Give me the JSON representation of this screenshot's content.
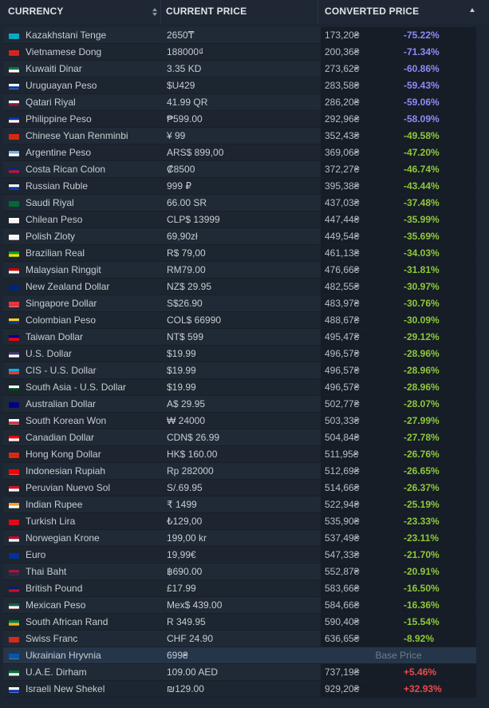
{
  "header": {
    "currency": "CURRENCY",
    "current_price": "CURRENT PRICE",
    "converted_price": "CONVERTED PRICE"
  },
  "rows": [
    {
      "flag": "kz",
      "name": "Kazakhstani Tenge",
      "price": "2650₸",
      "converted": "173,20₴",
      "pct": "-75.22%",
      "cls": "blue"
    },
    {
      "flag": "vn",
      "name": "Vietnamese Dong",
      "price": "188000₫",
      "converted": "200,36₴",
      "pct": "-71.34%",
      "cls": "blue"
    },
    {
      "flag": "kw",
      "name": "Kuwaiti Dinar",
      "price": "3.35 KD",
      "converted": "273,62₴",
      "pct": "-60.86%",
      "cls": "blue"
    },
    {
      "flag": "uy",
      "name": "Uruguayan Peso",
      "price": "$U429",
      "converted": "283,58₴",
      "pct": "-59.43%",
      "cls": "blue"
    },
    {
      "flag": "qa",
      "name": "Qatari Riyal",
      "price": "41.99 QR",
      "converted": "286,20₴",
      "pct": "-59.06%",
      "cls": "blue"
    },
    {
      "flag": "ph",
      "name": "Philippine Peso",
      "price": "₱599.00",
      "converted": "292,96₴",
      "pct": "-58.09%",
      "cls": "blue"
    },
    {
      "flag": "cn",
      "name": "Chinese Yuan Renminbi",
      "price": "¥ 99",
      "converted": "352,43₴",
      "pct": "-49.58%",
      "cls": "green"
    },
    {
      "flag": "ar",
      "name": "Argentine Peso",
      "price": "ARS$ 899,00",
      "converted": "369,06₴",
      "pct": "-47.20%",
      "cls": "green"
    },
    {
      "flag": "cr",
      "name": "Costa Rican Colon",
      "price": "₡8500",
      "converted": "372,27₴",
      "pct": "-46.74%",
      "cls": "green"
    },
    {
      "flag": "ru",
      "name": "Russian Ruble",
      "price": "999 ₽",
      "converted": "395,38₴",
      "pct": "-43.44%",
      "cls": "green"
    },
    {
      "flag": "sa",
      "name": "Saudi Riyal",
      "price": "66.00 SR",
      "converted": "437,03₴",
      "pct": "-37.48%",
      "cls": "green"
    },
    {
      "flag": "cl",
      "name": "Chilean Peso",
      "price": "CLP$ 13999",
      "converted": "447,44₴",
      "pct": "-35.99%",
      "cls": "green"
    },
    {
      "flag": "pl",
      "name": "Polish Zloty",
      "price": "69,90zł",
      "converted": "449,54₴",
      "pct": "-35.69%",
      "cls": "green"
    },
    {
      "flag": "br",
      "name": "Brazilian Real",
      "price": "R$ 79,00",
      "converted": "461,13₴",
      "pct": "-34.03%",
      "cls": "green"
    },
    {
      "flag": "my",
      "name": "Malaysian Ringgit",
      "price": "RM79.00",
      "converted": "476,66₴",
      "pct": "-31.81%",
      "cls": "green"
    },
    {
      "flag": "nz",
      "name": "New Zealand Dollar",
      "price": "NZ$ 29.95",
      "converted": "482,55₴",
      "pct": "-30.97%",
      "cls": "green"
    },
    {
      "flag": "sg",
      "name": "Singapore Dollar",
      "price": "S$26.90",
      "converted": "483,97₴",
      "pct": "-30.76%",
      "cls": "green"
    },
    {
      "flag": "co",
      "name": "Colombian Peso",
      "price": "COL$ 66990",
      "converted": "488,67₴",
      "pct": "-30.09%",
      "cls": "green"
    },
    {
      "flag": "tw",
      "name": "Taiwan Dollar",
      "price": "NT$ 599",
      "converted": "495,47₴",
      "pct": "-29.12%",
      "cls": "green"
    },
    {
      "flag": "us",
      "name": "U.S. Dollar",
      "price": "$19.99",
      "converted": "496,57₴",
      "pct": "-28.96%",
      "cls": "green"
    },
    {
      "flag": "az",
      "name": "CIS - U.S. Dollar",
      "price": "$19.99",
      "converted": "496,57₴",
      "pct": "-28.96%",
      "cls": "green"
    },
    {
      "flag": "pk",
      "name": "South Asia - U.S. Dollar",
      "price": "$19.99",
      "converted": "496,57₴",
      "pct": "-28.96%",
      "cls": "green"
    },
    {
      "flag": "au",
      "name": "Australian Dollar",
      "price": "A$ 29.95",
      "converted": "502,77₴",
      "pct": "-28.07%",
      "cls": "green"
    },
    {
      "flag": "kr",
      "name": "South Korean Won",
      "price": "₩ 24000",
      "converted": "503,33₴",
      "pct": "-27.99%",
      "cls": "green"
    },
    {
      "flag": "ca",
      "name": "Canadian Dollar",
      "price": "CDN$ 26.99",
      "converted": "504,84₴",
      "pct": "-27.78%",
      "cls": "green"
    },
    {
      "flag": "hk",
      "name": "Hong Kong Dollar",
      "price": "HK$ 160.00",
      "converted": "511,95₴",
      "pct": "-26.76%",
      "cls": "green"
    },
    {
      "flag": "id",
      "name": "Indonesian Rupiah",
      "price": "Rp 282000",
      "converted": "512,69₴",
      "pct": "-26.65%",
      "cls": "green"
    },
    {
      "flag": "pe",
      "name": "Peruvian Nuevo Sol",
      "price": "S/.69.95",
      "converted": "514,66₴",
      "pct": "-26.37%",
      "cls": "green"
    },
    {
      "flag": "in",
      "name": "Indian Rupee",
      "price": "₹ 1499",
      "converted": "522,94₴",
      "pct": "-25.19%",
      "cls": "green"
    },
    {
      "flag": "tr",
      "name": "Turkish Lira",
      "price": "₺129,00",
      "converted": "535,90₴",
      "pct": "-23.33%",
      "cls": "green"
    },
    {
      "flag": "no",
      "name": "Norwegian Krone",
      "price": "199,00 kr",
      "converted": "537,49₴",
      "pct": "-23.11%",
      "cls": "green"
    },
    {
      "flag": "eu",
      "name": "Euro",
      "price": "19,99€",
      "converted": "547,33₴",
      "pct": "-21.70%",
      "cls": "green"
    },
    {
      "flag": "th",
      "name": "Thai Baht",
      "price": "฿690.00",
      "converted": "552,87₴",
      "pct": "-20.91%",
      "cls": "green"
    },
    {
      "flag": "gb",
      "name": "British Pound",
      "price": "£17.99",
      "converted": "583,66₴",
      "pct": "-16.50%",
      "cls": "green"
    },
    {
      "flag": "mx",
      "name": "Mexican Peso",
      "price": "Mex$ 439.00",
      "converted": "584,66₴",
      "pct": "-16.36%",
      "cls": "green"
    },
    {
      "flag": "za",
      "name": "South African Rand",
      "price": "R 349.95",
      "converted": "590,40₴",
      "pct": "-15.54%",
      "cls": "green"
    },
    {
      "flag": "ch",
      "name": "Swiss Franc",
      "price": "CHF 24.90",
      "converted": "636,65₴",
      "pct": "-8.92%",
      "cls": "green"
    },
    {
      "flag": "ua",
      "name": "Ukrainian Hryvnia",
      "price": "699₴",
      "converted": "",
      "pct": "",
      "cls": "base",
      "base_label": "Base Price"
    },
    {
      "flag": "ae",
      "name": "U.A.E. Dirham",
      "price": "109.00 AED",
      "converted": "737,19₴",
      "pct": "+5.46%",
      "cls": "red"
    },
    {
      "flag": "il",
      "name": "Israeli New Shekel",
      "price": "₪129.00",
      "converted": "929,20₴",
      "pct": "+32.93%",
      "cls": "red"
    }
  ],
  "flags": {
    "kz": [
      "#00afca",
      "#00afca",
      "#00afca"
    ],
    "vn": [
      "#da251d",
      "#da251d",
      "#da251d"
    ],
    "kw": [
      "#007a3d",
      "#ffffff",
      "#ce1126"
    ],
    "uy": [
      "#ffffff",
      "#0038a8",
      "#ffffff"
    ],
    "qa": [
      "#ffffff",
      "#8a1538",
      "#8a1538"
    ],
    "ph": [
      "#0038a8",
      "#ffffff",
      "#ce1126"
    ],
    "cn": [
      "#de2910",
      "#de2910",
      "#de2910"
    ],
    "ar": [
      "#74acdf",
      "#ffffff",
      "#74acdf"
    ],
    "cr": [
      "#002b7f",
      "#ce1126",
      "#002b7f"
    ],
    "ru": [
      "#ffffff",
      "#0039a6",
      "#d52b1e"
    ],
    "sa": [
      "#006c35",
      "#006c35",
      "#006c35"
    ],
    "cl": [
      "#ffffff",
      "#ffffff",
      "#d52b1e"
    ],
    "pl": [
      "#ffffff",
      "#ffffff",
      "#dc143c"
    ],
    "br": [
      "#009c3b",
      "#ffdf00",
      "#009c3b"
    ],
    "my": [
      "#cc0001",
      "#ffffff",
      "#010066"
    ],
    "nz": [
      "#00247d",
      "#00247d",
      "#00247d"
    ],
    "sg": [
      "#ef3340",
      "#ef3340",
      "#ffffff"
    ],
    "co": [
      "#fcd116",
      "#003893",
      "#ce1126"
    ],
    "tw": [
      "#000095",
      "#fe0000",
      "#fe0000"
    ],
    "us": [
      "#3c3b6e",
      "#ffffff",
      "#b22234"
    ],
    "az": [
      "#00b5e2",
      "#ef3340",
      "#509e2f"
    ],
    "pk": [
      "#ffffff",
      "#01411c",
      "#01411c"
    ],
    "au": [
      "#00008b",
      "#00008b",
      "#00008b"
    ],
    "kr": [
      "#ffffff",
      "#cd2e3a",
      "#ffffff"
    ],
    "ca": [
      "#ff0000",
      "#ffffff",
      "#ff0000"
    ],
    "hk": [
      "#de2910",
      "#de2910",
      "#de2910"
    ],
    "id": [
      "#ff0000",
      "#ff0000",
      "#ffffff"
    ],
    "pe": [
      "#d91023",
      "#ffffff",
      "#d91023"
    ],
    "in": [
      "#ff9933",
      "#ffffff",
      "#138808"
    ],
    "tr": [
      "#e30a17",
      "#e30a17",
      "#e30a17"
    ],
    "no": [
      "#ba0c2f",
      "#ffffff",
      "#00205b"
    ],
    "eu": [
      "#003399",
      "#003399",
      "#003399"
    ],
    "th": [
      "#a51931",
      "#2d2a4a",
      "#a51931"
    ],
    "gb": [
      "#012169",
      "#c8102e",
      "#012169"
    ],
    "mx": [
      "#006847",
      "#ffffff",
      "#ce1126"
    ],
    "za": [
      "#007a4d",
      "#ffb612",
      "#de3831"
    ],
    "ch": [
      "#d52b1e",
      "#d52b1e",
      "#d52b1e"
    ],
    "ua": [
      "#0057b7",
      "#0057b7",
      "#ffd700"
    ],
    "ae": [
      "#00732f",
      "#ffffff",
      "#000000"
    ],
    "il": [
      "#ffffff",
      "#0038b8",
      "#ffffff"
    ]
  },
  "colors": {
    "negative_strong": "#8c8cf7",
    "negative": "#8fc83a",
    "positive": "#ea4a4a",
    "base": "#6f7e8c"
  },
  "icons": {
    "sort": "sort-updown-icon",
    "sort_desc": "sort-down-icon"
  }
}
